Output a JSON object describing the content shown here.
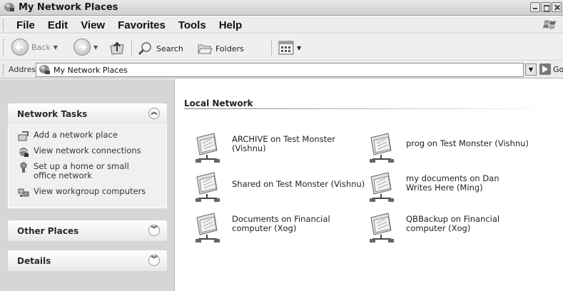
{
  "window": {
    "title": "My Network Places"
  },
  "menu": {
    "items": [
      "File",
      "Edit",
      "View",
      "Favorites",
      "Tools",
      "Help"
    ]
  },
  "toolbar": {
    "back_label": "Back",
    "search_label": "Search",
    "folders_label": "Folders"
  },
  "address": {
    "label": "Address",
    "value": "My Network Places",
    "go_label": "Go"
  },
  "task_pane": {
    "network_tasks": {
      "title": "Network Tasks",
      "items": [
        "Add a network place",
        "View network connections",
        "Set up a home or small office network",
        "View workgroup computers"
      ]
    },
    "other_places": {
      "title": "Other Places"
    },
    "details": {
      "title": "Details"
    }
  },
  "content": {
    "group_title": "Local Network",
    "shares": [
      "ARCHIVE on Test Monster (Vishnu)",
      "prog on Test Monster (Vishnu)",
      "Shared on Test Monster (Vishnu)",
      "my documents on Dan Writes Here (Ming)",
      "Documents on Financial computer (Xog)",
      "QBBackup on Financial computer (Xog)"
    ]
  },
  "colors": {
    "taskpane_bg": "#d6d6d6",
    "content_bg": "#ffffff",
    "chrome_bg": "#ececec"
  }
}
